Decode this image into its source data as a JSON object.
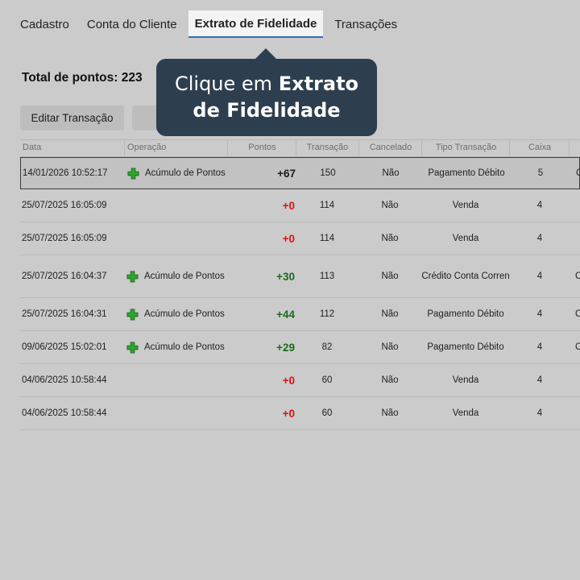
{
  "tabs": [
    {
      "label": "Cadastro"
    },
    {
      "label": "Conta do Cliente"
    },
    {
      "label": "Extrato de Fidelidade"
    },
    {
      "label": "Transações"
    }
  ],
  "total": {
    "label": "Total de pontos: 223"
  },
  "buttons": {
    "edit": "Editar Transação",
    "other": ""
  },
  "tooltip": {
    "prefix": "Clique em ",
    "bold1": "Extrato",
    "bold2": "de Fidelidade"
  },
  "table": {
    "headers": [
      "Data",
      "Operação",
      "Pontos",
      "Transação",
      "Cancelado",
      "Tipo Transação",
      "Caixa",
      ""
    ],
    "rows": [
      {
        "date": "14/01/2026 10:52:17",
        "op": "Acúmulo de Pontos",
        "icon": "plus-icon",
        "pts": "+67",
        "trans": "150",
        "canc": "Não",
        "tipo": "Pagamento Débito",
        "caixa": "5",
        "extra": "C"
      },
      {
        "date": "25/07/2025 16:05:09",
        "op": "",
        "icon": "",
        "pts": "+0",
        "trans": "114",
        "canc": "Não",
        "tipo": "Venda",
        "caixa": "4",
        "extra": ""
      },
      {
        "date": "25/07/2025 16:05:09",
        "op": "",
        "icon": "",
        "pts": "+0",
        "trans": "114",
        "canc": "Não",
        "tipo": "Venda",
        "caixa": "4",
        "extra": ""
      },
      {
        "date": "25/07/2025 16:04:37",
        "op": "Acúmulo de Pontos",
        "icon": "plus-icon",
        "pts": "+30",
        "trans": "113",
        "canc": "Não",
        "tipo": "Crédito Conta Corren",
        "caixa": "4",
        "extra": "C"
      },
      {
        "date": "25/07/2025 16:04:31",
        "op": "Acúmulo de Pontos",
        "icon": "plus-icon",
        "pts": "+44",
        "trans": "112",
        "canc": "Não",
        "tipo": "Pagamento Débito",
        "caixa": "4",
        "extra": "C"
      },
      {
        "date": "09/06/2025 15:02:01",
        "op": "Acúmulo de Pontos",
        "icon": "plus-icon",
        "pts": "+29",
        "trans": "82",
        "canc": "Não",
        "tipo": "Pagamento Débito",
        "caixa": "4",
        "extra": "C"
      },
      {
        "date": "04/06/2025 10:58:44",
        "op": "",
        "icon": "",
        "pts": "+0",
        "trans": "60",
        "canc": "Não",
        "tipo": "Venda",
        "caixa": "4",
        "extra": ""
      },
      {
        "date": "04/06/2025 10:58:44",
        "op": "",
        "icon": "",
        "pts": "+0",
        "trans": "60",
        "canc": "Não",
        "tipo": "Venda",
        "caixa": "4",
        "extra": ""
      }
    ]
  },
  "colors": {
    "accent": "#2c6fbd",
    "tooltip_bg": "#2d3e4f",
    "positive": "#1a6e1a",
    "zero": "#e01010",
    "plus_icon": "#2fa52f"
  }
}
